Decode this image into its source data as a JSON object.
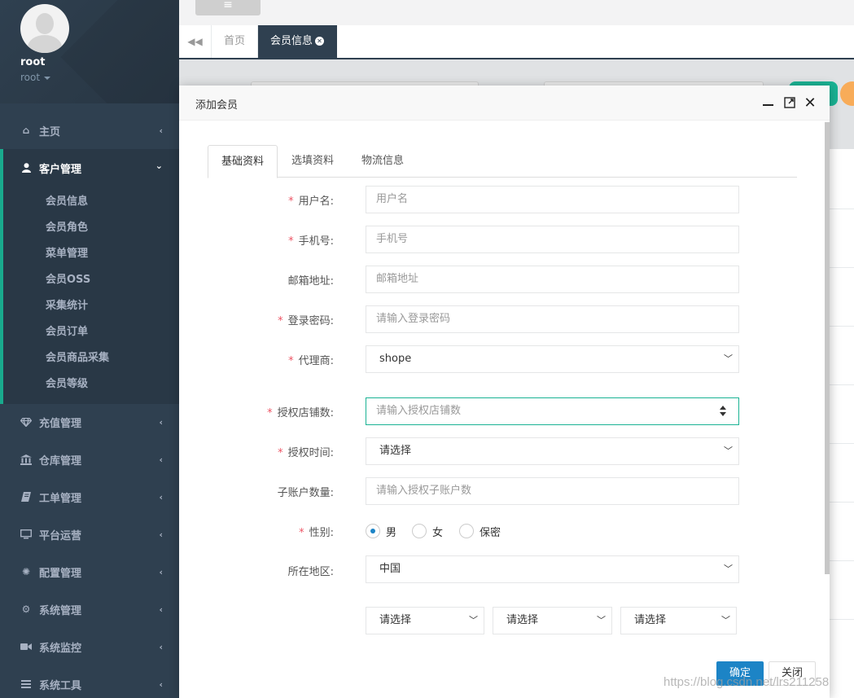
{
  "profile": {
    "name": "root",
    "role": "root"
  },
  "nav": {
    "items": [
      {
        "label": "主页",
        "icon": "home-icon"
      },
      {
        "label": "客户管理",
        "icon": "user-icon"
      },
      {
        "label": "充值管理",
        "icon": "diamond-icon"
      },
      {
        "label": "仓库管理",
        "icon": "bank-icon"
      },
      {
        "label": "工单管理",
        "icon": "book-icon"
      },
      {
        "label": "平台运营",
        "icon": "monitor-icon"
      },
      {
        "label": "配置管理",
        "icon": "gear-flower-icon"
      },
      {
        "label": "系统管理",
        "icon": "gear-icon"
      },
      {
        "label": "系统监控",
        "icon": "video-camera-icon"
      },
      {
        "label": "系统工具",
        "icon": "bars-icon"
      }
    ],
    "submenu": [
      "会员信息",
      "会员角色",
      "菜单管理",
      "会员OSS",
      "采集统计",
      "会员订单",
      "会员商品采集",
      "会员等级"
    ]
  },
  "topbar": {
    "menu_icon": "hamburger-icon"
  },
  "tabs": {
    "home": "首页",
    "active": "会员信息"
  },
  "modal": {
    "title": "添加会员",
    "tabs": [
      "基础资料",
      "选填资料",
      "物流信息"
    ],
    "fields": {
      "username": {
        "label": "用户名:",
        "placeholder": "用户名"
      },
      "phone": {
        "label": "手机号:",
        "placeholder": "手机号"
      },
      "email": {
        "label": "邮箱地址:",
        "placeholder": "邮箱地址"
      },
      "password": {
        "label": "登录密码:",
        "placeholder": "请输入登录密码"
      },
      "agent": {
        "label": "代理商:",
        "value": "shope"
      },
      "shops": {
        "label": "授权店铺数:",
        "placeholder": "请输入授权店铺数"
      },
      "auth_time": {
        "label": "授权时间:",
        "value": "请选择"
      },
      "sub_accounts": {
        "label": "子账户数量:",
        "placeholder": "请输入授权子账户数"
      },
      "gender": {
        "label": "性别:",
        "options": [
          "男",
          "女",
          "保密"
        ],
        "selected": "男"
      },
      "region": {
        "label": "所在地区:",
        "value": "中国",
        "sub": [
          "请选择",
          "请选择",
          "请选择"
        ]
      }
    },
    "buttons": {
      "ok": "确定",
      "cancel": "关闭"
    }
  },
  "watermark": "https://blog.csdn.net/lrs211258",
  "colors": {
    "sidebar": "#2f4050",
    "accent": "#19aa8d",
    "primary": "#1c84c6",
    "required": "#ed5565"
  }
}
